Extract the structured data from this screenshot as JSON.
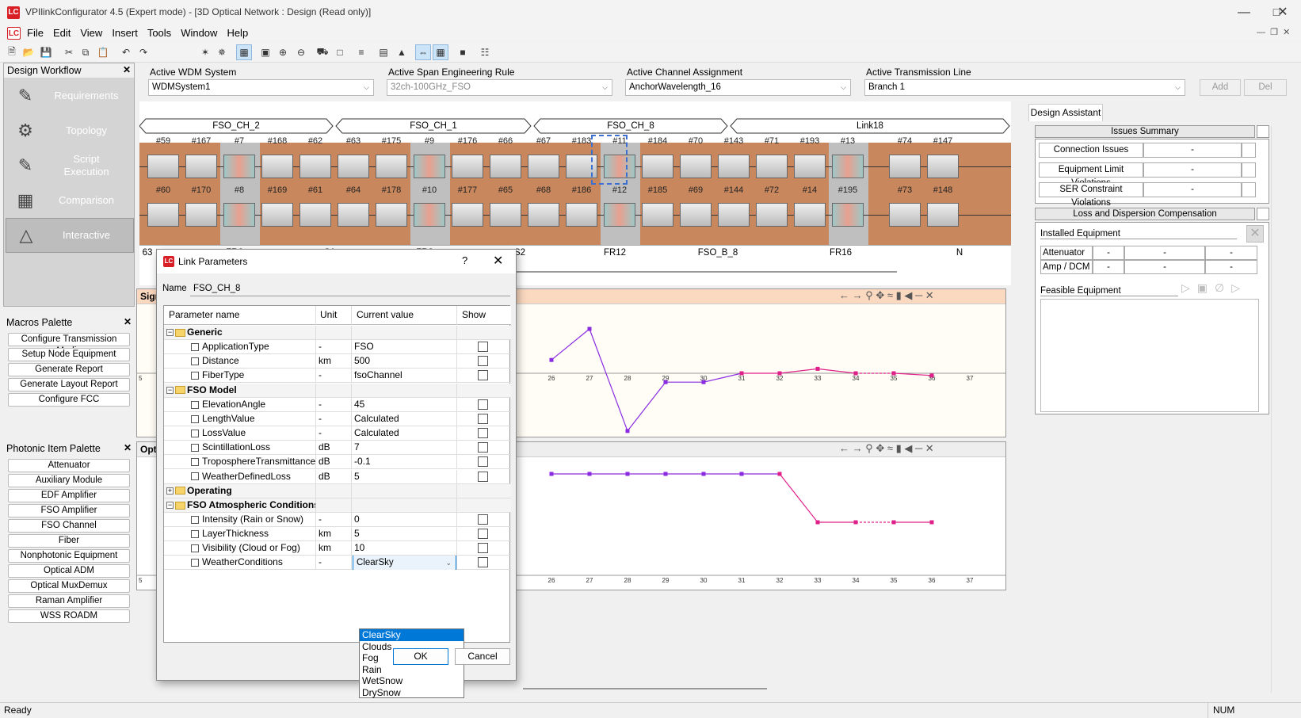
{
  "app": {
    "title": "VPIlinkConfigurator 4.5 (Expert mode) - [3D Optical Network : Design (Read only)]",
    "logo": "LC"
  },
  "menu": [
    "File",
    "Edit",
    "View",
    "Insert",
    "Tools",
    "Window",
    "Help"
  ],
  "workflow": {
    "title": "Design Workflow",
    "items": [
      {
        "label": "Requirements",
        "icon": "requirements-icon"
      },
      {
        "label": "Topology",
        "icon": "topology-icon"
      },
      {
        "label": "Script\nExecution",
        "icon": "script-icon"
      },
      {
        "label": "Comparison",
        "icon": "comparison-icon"
      },
      {
        "label": "Interactive",
        "icon": "interactive-icon"
      }
    ]
  },
  "macros": {
    "title": "Macros Palette",
    "items": [
      "Configure Transmission Media",
      "Setup Node Equipment",
      "Generate Report",
      "Generate Layout Report",
      "Configure FCC"
    ]
  },
  "photonic": {
    "title": "Photonic Item Palette",
    "items": [
      "Attenuator",
      "Auxiliary Module",
      "EDF Amplifier",
      "FSO Amplifier",
      "FSO Channel",
      "Fiber",
      "Nonphotonic Equipment",
      "Optical ADM",
      "Optical MuxDemux",
      "Raman Amplifier",
      "WSS ROADM"
    ]
  },
  "selectors": {
    "wdm": {
      "label": "Active WDM System",
      "value": "WDMSystem1"
    },
    "span": {
      "label": "Active Span Engineering Rule",
      "value": "32ch-100GHz_FSO"
    },
    "channel": {
      "label": "Active Channel Assignment",
      "value": "AnchorWavelength_16"
    },
    "line": {
      "label": "Active Transmission Line",
      "value": "Branch 1"
    },
    "add": "Add",
    "del": "Del"
  },
  "links": [
    "FSO_CH_2",
    "FSO_CH_1",
    "FSO_CH_8",
    "Link18"
  ],
  "top_ids": [
    "#59",
    "#167",
    "#7",
    "#168",
    "#62",
    "#63",
    "#175",
    "#9",
    "#176",
    "#66",
    "#67",
    "#183",
    "#11",
    "#184",
    "#70",
    "#143",
    "#71",
    "#193",
    "#13",
    "#74",
    "#147"
  ],
  "bottom_ids": [
    "#60",
    "#170",
    "#8",
    "#169",
    "#61",
    "#64",
    "#178",
    "#10",
    "#177",
    "#65",
    "#68",
    "#186",
    "#12",
    "#185",
    "#69",
    "#144",
    "#72",
    "#14",
    "#195",
    "#73",
    "#148"
  ],
  "bottom_labels": [
    "63",
    "FR6",
    "S1",
    "FR8",
    "S2",
    "FR12",
    "FSO_B_8",
    "FR16",
    "N"
  ],
  "chart1": {
    "title": "Sign",
    "x_ticks": [
      "5",
      "26",
      "27",
      "28",
      "29",
      "30",
      "31",
      "32",
      "33",
      "34",
      "35",
      "36",
      "37"
    ]
  },
  "chart2": {
    "title": "Opti",
    "x_ticks": [
      "5",
      "26",
      "27",
      "28",
      "29",
      "30",
      "31",
      "32",
      "33",
      "34",
      "35",
      "36",
      "37"
    ]
  },
  "chart_data": [
    {
      "type": "line",
      "x": [
        26,
        27,
        28,
        29,
        30,
        31,
        32,
        33,
        34,
        35,
        36
      ],
      "series": [
        {
          "values": [
            0.3,
            1.0,
            -1.3,
            -0.2,
            -0.2,
            0,
            0,
            0.1,
            0,
            0,
            -0.05
          ]
        }
      ]
    },
    {
      "type": "line",
      "x": [
        26,
        27,
        28,
        29,
        30,
        31,
        32,
        33,
        34,
        35,
        36
      ],
      "series": [
        {
          "values": [
            1.0,
            1.0,
            1.0,
            1.0,
            1.0,
            1.0,
            1.0,
            -1.0,
            -1.0,
            -1.0,
            -1.0
          ]
        }
      ]
    }
  ],
  "dialog": {
    "title": "Link Parameters",
    "help": "?",
    "name_label": "Name",
    "name_value": "FSO_CH_8",
    "columns": [
      "Parameter name",
      "Unit",
      "Current value",
      "Show"
    ],
    "rows": [
      {
        "kind": "group",
        "label": "Generic",
        "open": true
      },
      {
        "kind": "param",
        "label": "ApplicationType",
        "unit": "-",
        "value": "FSO"
      },
      {
        "kind": "param",
        "label": "Distance",
        "unit": "km",
        "value": "500"
      },
      {
        "kind": "param",
        "label": "FiberType",
        "unit": "-",
        "value": "fsoChannel"
      },
      {
        "kind": "group",
        "label": "FSO Model",
        "open": true
      },
      {
        "kind": "param",
        "label": "ElevationAngle",
        "unit": "-",
        "value": "45"
      },
      {
        "kind": "param",
        "label": "LengthValue",
        "unit": "-",
        "value": "Calculated"
      },
      {
        "kind": "param",
        "label": "LossValue",
        "unit": "-",
        "value": "Calculated"
      },
      {
        "kind": "param",
        "label": "ScintillationLoss",
        "unit": "dB",
        "value": "7"
      },
      {
        "kind": "param",
        "label": "TroposphereTransmittance",
        "unit": "dB",
        "value": "-0.1"
      },
      {
        "kind": "param",
        "label": "WeatherDefinedLoss",
        "unit": "dB",
        "value": "5"
      },
      {
        "kind": "group",
        "label": "Operating",
        "open": false
      },
      {
        "kind": "group",
        "label": "FSO Atmospheric Conditions",
        "open": true
      },
      {
        "kind": "param",
        "label": "Intensity (Rain or Snow)",
        "unit": "-",
        "value": "0"
      },
      {
        "kind": "param",
        "label": "LayerThickness",
        "unit": "km",
        "value": "5"
      },
      {
        "kind": "param",
        "label": "Visibility (Cloud or Fog)",
        "unit": "km",
        "value": "10"
      },
      {
        "kind": "param",
        "label": "WeatherConditions",
        "unit": "-",
        "value": "ClearSky"
      }
    ],
    "dropdown": [
      "ClearSky",
      "Clouds",
      "Fog",
      "Rain",
      "WetSnow",
      "DrySnow"
    ],
    "ok": "OK",
    "cancel": "Cancel"
  },
  "assistant": {
    "tab": "Design Assistant",
    "issues_title": "Issues Summary",
    "issues": [
      {
        "label": "Connection Issues",
        "value": "-"
      },
      {
        "label": "Equipment Limit Violations",
        "value": "-"
      },
      {
        "label": "SER Constraint Violations",
        "value": "-"
      }
    ],
    "ldc_title": "Loss and Dispersion Compensation",
    "installed": "Installed Equipment",
    "inst_rows": [
      {
        "label": "Attenuator",
        "vals": [
          "-",
          "-",
          "-"
        ]
      },
      {
        "label": "Amp / DCM",
        "vals": [
          "-",
          "-",
          "-"
        ]
      }
    ],
    "feasible": "Feasible Equipment"
  },
  "status": {
    "left": "Ready",
    "right": "NUM"
  }
}
